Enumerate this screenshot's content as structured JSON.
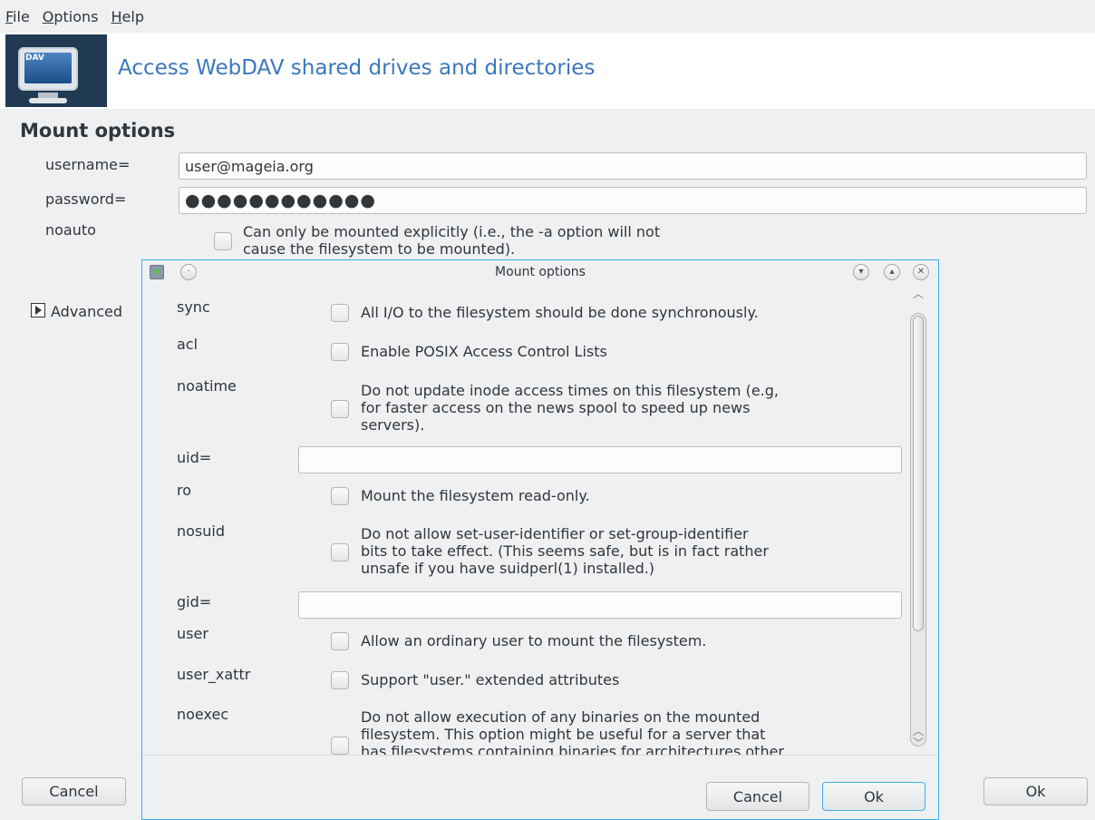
{
  "menu": {
    "file": {
      "u": "F",
      "rest": "ile"
    },
    "options": {
      "u": "O",
      "rest": "ptions"
    },
    "help": {
      "u": "H",
      "rest": "elp"
    }
  },
  "banner": {
    "icon_text": "DAV",
    "title": "Access WebDAV shared drives and directories"
  },
  "main": {
    "section_title": "Mount options",
    "username_label": "username=",
    "username_value": "user@mageia.org",
    "password_label": "password=",
    "password_value": "●●●●●●●●●●●●",
    "noauto_label": "noauto",
    "noauto_desc_1": "Can only be mounted explicitly (i.e., the -a option will not",
    "noauto_desc_2": "cause the filesystem to be mounted).",
    "advanced_label": "Advanced",
    "cancel_label": "Cancel",
    "ok_label": "Ok"
  },
  "dialog": {
    "title": "Mount options",
    "options": [
      {
        "label": "sync",
        "desc": [
          "All I/O to the filesystem should be done synchronously."
        ]
      },
      {
        "label": "acl",
        "desc": [
          "Enable POSIX Access Control Lists"
        ]
      },
      {
        "label": "noatime",
        "desc": [
          "Do not update inode access times on this filesystem (e.g,",
          "for faster access on the news spool to speed up news",
          "servers)."
        ]
      },
      {
        "label": "uid="
      },
      {
        "label": "ro",
        "desc": [
          "Mount the filesystem read-only."
        ]
      },
      {
        "label": "nosuid",
        "desc": [
          "Do not allow set-user-identifier or set-group-identifier",
          "bits to take effect. (This seems safe, but is in fact rather",
          "unsafe if you have suidperl(1) installed.)"
        ]
      },
      {
        "label": "gid="
      },
      {
        "label": "user",
        "desc": [
          "Allow an ordinary user to mount the filesystem."
        ]
      },
      {
        "label": "user_xattr",
        "desc": [
          "Support \"user.\" extended attributes"
        ]
      },
      {
        "label": "noexec",
        "desc": [
          "Do not allow execution of any binaries on the mounted",
          "filesystem. This option might be useful for a server that",
          "has filesystems containing binaries for architectures other"
        ]
      }
    ],
    "cancel_label": "Cancel",
    "ok_label": "Ok"
  }
}
